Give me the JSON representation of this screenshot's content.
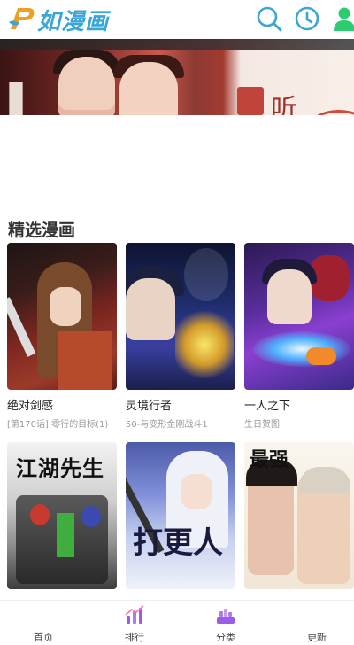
{
  "app": {
    "logo_text": "如漫画"
  },
  "banner": {
    "text": "听"
  },
  "section": {
    "title": "精选漫画"
  },
  "comics": [
    {
      "title": "绝对剑感",
      "subtitle": "[第170话] 零行的目标(1)"
    },
    {
      "title": "灵境行者",
      "subtitle": "50-与变形金刚战斗1"
    },
    {
      "title": "一人之下",
      "subtitle": "生日贺图"
    },
    {
      "title": "",
      "subtitle": "",
      "cover_text": "江湖先生"
    },
    {
      "title": "",
      "subtitle": "",
      "cover_text": "打更人"
    },
    {
      "title": "",
      "subtitle": "",
      "cover_text": "最强"
    }
  ],
  "bottom_nav": [
    {
      "label": "首页",
      "icon": "home-icon"
    },
    {
      "label": "排行",
      "icon": "ranking-icon"
    },
    {
      "label": "分类",
      "icon": "category-icon"
    },
    {
      "label": "更新",
      "icon": "update-icon"
    }
  ],
  "colors": {
    "accent": "#3aa6d8",
    "user_icon": "#2ecc71",
    "nav_accent": "#9b5de5"
  }
}
